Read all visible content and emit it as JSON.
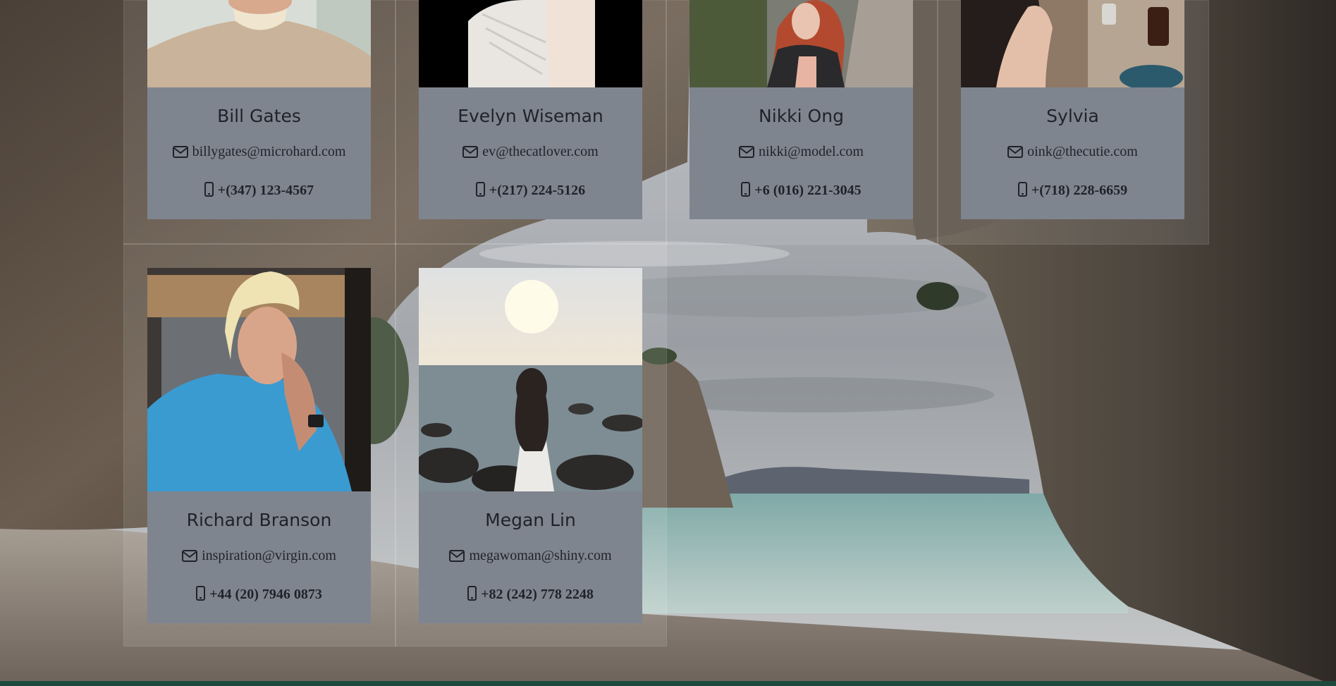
{
  "contacts": [
    {
      "name": "Bill Gates",
      "email": "billygates@microhard.com",
      "phone": "+(347) 123-4567",
      "photo": "older man in beige sweater"
    },
    {
      "name": "Evelyn Wiseman",
      "email": "ev@thecatlover.com",
      "phone": "+(217) 224-5126",
      "photo": "person in white knit sweater"
    },
    {
      "name": "Nikki Ong",
      "email": "nikki@model.com",
      "phone": "+6 (016) 221-3045",
      "photo": "red-haired woman on street"
    },
    {
      "name": "Sylvia",
      "email": "oink@thecutie.com",
      "phone": "+(718) 228-6659",
      "photo": "woman at cafe table"
    },
    {
      "name": "Richard Branson",
      "email": "inspiration@virgin.com",
      "phone": "+44 (20) 7946 0873",
      "photo": "blond man in blue shirt"
    },
    {
      "name": "Megan Lin",
      "email": "megawoman@shiny.com",
      "phone": "+82 (242) 778 2248",
      "photo": "woman on rocky beach"
    }
  ],
  "icons": {
    "email": "envelope-icon",
    "phone": "mobile-phone-icon"
  },
  "colors": {
    "card_info_bg": "#7f858f",
    "text": "#1f2329"
  }
}
